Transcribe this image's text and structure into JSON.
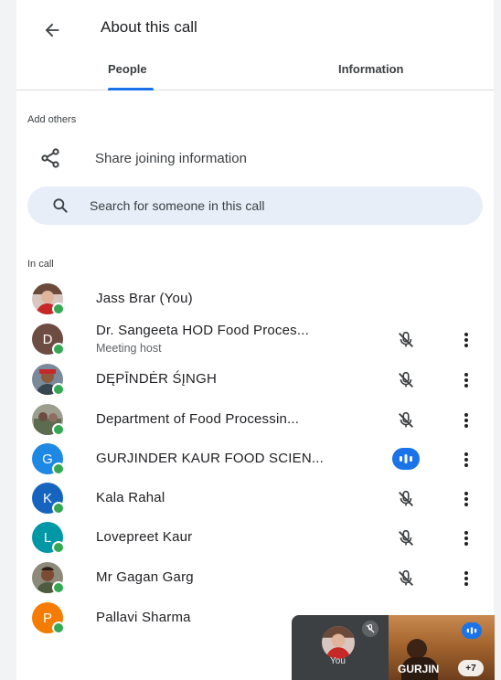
{
  "header": {
    "title": "About this call",
    "back_icon": "arrow-back-icon"
  },
  "tabs": [
    {
      "label": "People",
      "selected": true
    },
    {
      "label": "Information",
      "selected": false
    }
  ],
  "add_others": {
    "label": "Add others",
    "share_label": "Share joining information",
    "share_icon": "share-icon"
  },
  "search": {
    "placeholder": "Search for someone in this call",
    "icon": "search-icon"
  },
  "in_call_label": "In call",
  "participants": [
    {
      "name": "Jass Brar (You)",
      "avatar": "photo",
      "mic": "none"
    },
    {
      "name": "Dr. Sangeeta HOD Food Proces...",
      "sub": "Meeting host",
      "avatar": "D",
      "avatar_color": "#6d4c41",
      "mic": "muted"
    },
    {
      "name": "DĘPĪNDĖR ŚĮNGH",
      "avatar": "photo",
      "mic": "muted"
    },
    {
      "name": "Department of Food Processin...",
      "avatar": "photo",
      "mic": "muted"
    },
    {
      "name": "GURJINDER KAUR FOOD SCIEN...",
      "avatar": "G",
      "avatar_color": "#1e88e5",
      "mic": "speaking"
    },
    {
      "name": "Kala Rahal",
      "avatar": "K",
      "avatar_color": "#1565c0",
      "mic": "muted"
    },
    {
      "name": "Lovepreet Kaur",
      "avatar": "L",
      "avatar_color": "#0097a7",
      "mic": "muted"
    },
    {
      "name": "Mr Gagan Garg",
      "avatar": "photo",
      "mic": "muted"
    },
    {
      "name": "Pallavi Sharma",
      "avatar": "P",
      "avatar_color": "#f57c00",
      "mic": "muted"
    }
  ],
  "pip": {
    "self_label": "You",
    "other_label": "GURJIN",
    "more_count": "+7"
  },
  "colors": {
    "accent": "#1a73e8",
    "presence": "#34a853"
  }
}
